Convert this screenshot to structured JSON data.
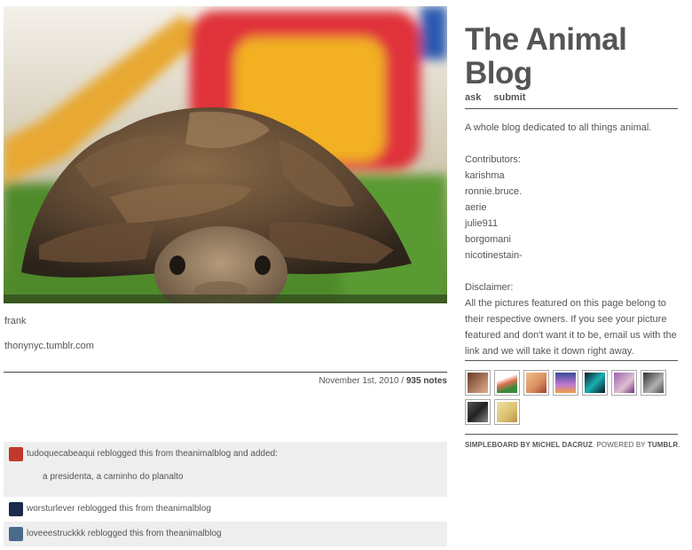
{
  "post": {
    "photo_icon": "tortoise-photo",
    "caption_name": "frank",
    "caption_source": "thonynyc.tumblr.com",
    "date": "November 1st, 2010",
    "separator": " / ",
    "notes_count": "935 notes"
  },
  "notes": [
    {
      "text": "tudoquecabeaqui reblogged this from theanimalblog and added:",
      "added": "a presidenta, a caminho do planalto",
      "avatar_color": "#c0392b"
    },
    {
      "text": "worsturlever reblogged this from theanimalblog",
      "avatar_color": "#1a2a4a"
    },
    {
      "text": "loveeestruckkk reblogged this from theanimalblog",
      "avatar_color": "#4a6a8a"
    }
  ],
  "sidebar": {
    "title_line1": "The Animal",
    "title_line2": "Blog",
    "nav": [
      "ask",
      "submit"
    ],
    "description": "A whole blog dedicated to all things animal.",
    "contributors_heading": "Contributors:",
    "contributors": [
      "karishma",
      "ronnie.bruce.",
      "aerie",
      "julie911",
      "borgomani",
      "nicotinestain-"
    ],
    "disclaimer_heading": "Disclaimer:",
    "disclaimer_text": "All the pictures featured on this page belong to their respective owners. If you see your picture featured and don't want it to be, email us with the link and we will take it down right away.",
    "followers": [
      {
        "color": "#6b3a2a"
      },
      {
        "color": "#e07050"
      },
      {
        "color": "#d88a5a"
      },
      {
        "color": "#3a4a9a"
      },
      {
        "color": "#1ab0b0"
      },
      {
        "color": "#9a60b0"
      },
      {
        "color": "#707070"
      },
      {
        "color": "#333333"
      },
      {
        "color": "#d8c070"
      }
    ],
    "credits_theme": "SIMPLEBOARD BY MICHEL DACRUZ",
    "credits_sep": ". POWERED BY ",
    "credits_tumblr": "TUMBLR",
    "credits_end": "."
  }
}
